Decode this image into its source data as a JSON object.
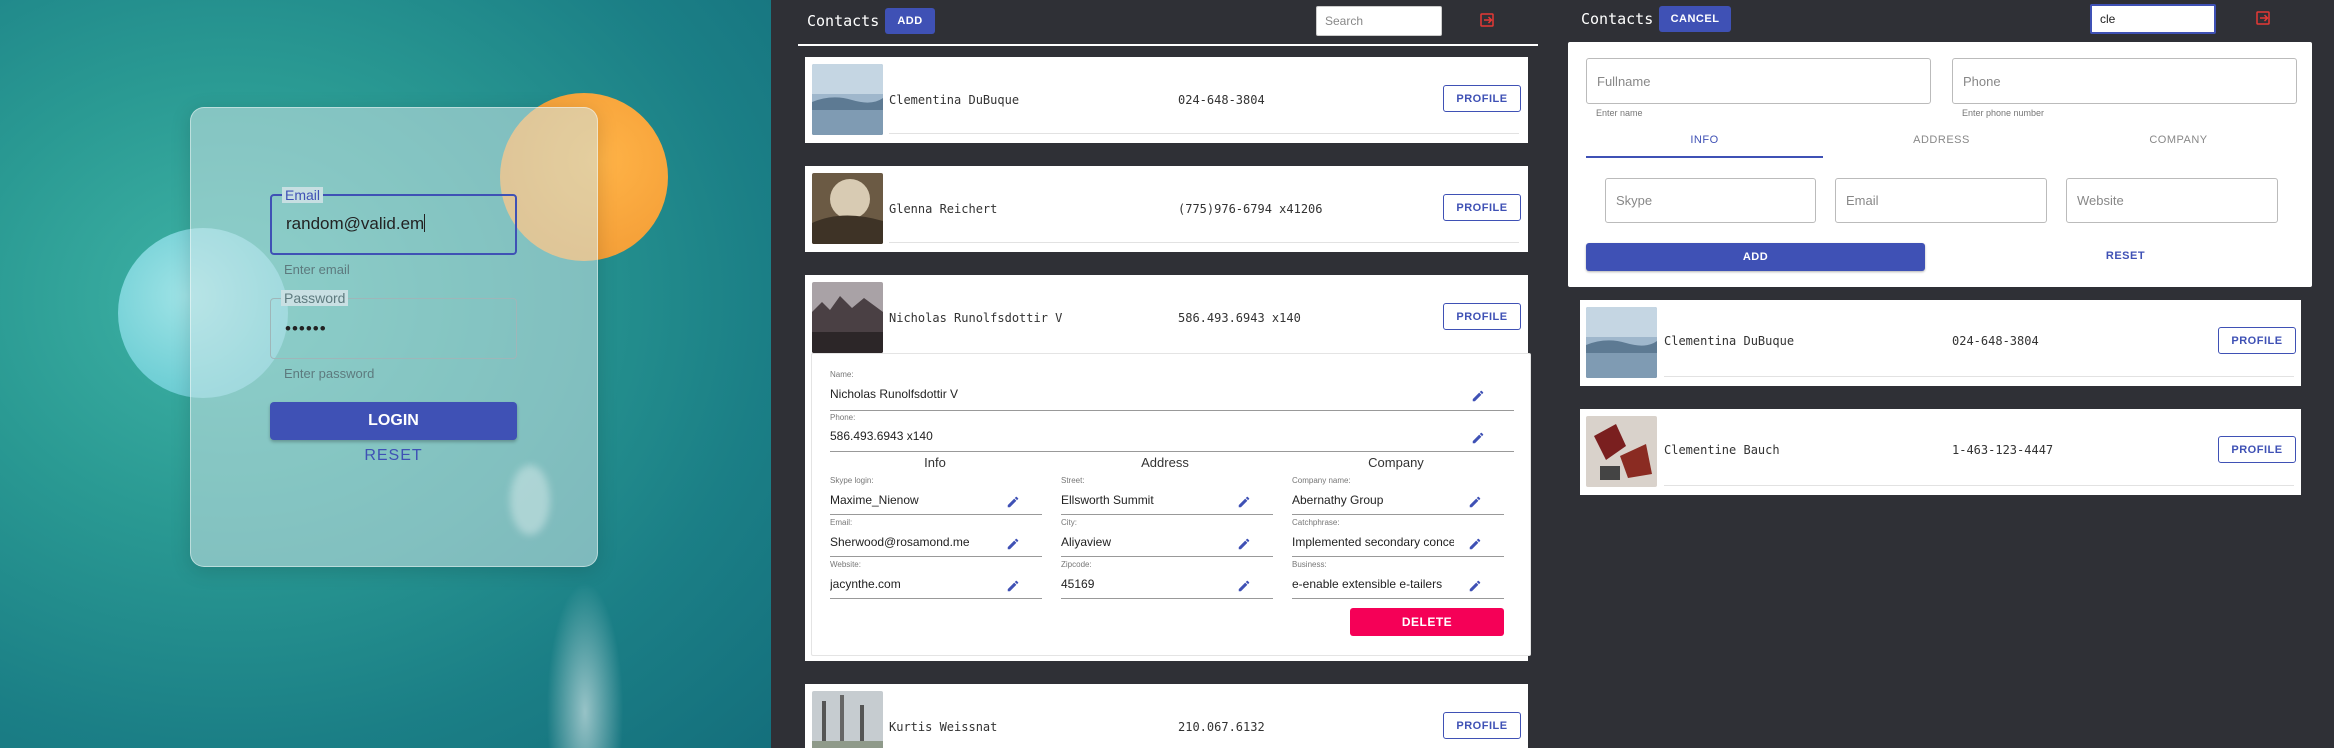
{
  "login": {
    "email_label": "Email",
    "email_value": "random@valid.em",
    "email_helper": "Enter email",
    "password_label": "Password",
    "password_value": "••••••",
    "password_helper": "Enter password",
    "login_label": "LOGIN",
    "reset_label": "RESET"
  },
  "list": {
    "title": "Contacts",
    "add_label": "ADD",
    "search_placeholder": "Search",
    "contacts": [
      {
        "name": "Clementina DuBuque",
        "phone": "024-648-3804",
        "profile_label": "PROFILE"
      },
      {
        "name": "Glenna Reichert",
        "phone": "(775)976-6794 x41206",
        "profile_label": "PROFILE"
      },
      {
        "name": "Nicholas Runolfsdottir V",
        "phone": "586.493.6943 x140",
        "profile_label": "PROFILE"
      },
      {
        "name": "Kurtis Weissnat",
        "phone": "210.067.6132",
        "profile_label": "PROFILE"
      }
    ],
    "detail": {
      "name_label": "Name:",
      "name_value": "Nicholas Runolfsdottir V",
      "phone_label": "Phone:",
      "phone_value": "586.493.6943 x140",
      "info_head": "Info",
      "address_head": "Address",
      "company_head": "Company",
      "skype_label": "Skype login:",
      "skype_value": "Maxime_Nienow",
      "email_label": "Email:",
      "email_value": "Sherwood@rosamond.me",
      "website_label": "Website:",
      "website_value": "jacynthe.com",
      "street_label": "Street:",
      "street_value": "Ellsworth Summit",
      "city_label": "City:",
      "city_value": "Aliyaview",
      "zipcode_label": "Zipcode:",
      "zipcode_value": "45169",
      "company_name_label": "Company name:",
      "company_name_value": "Abernathy Group",
      "catchphrase_label": "Catchphrase:",
      "catchphrase_value": "Implemented secondary concept",
      "business_label": "Business:",
      "business_value": "e-enable extensible e-tailers",
      "delete_label": "DELETE"
    }
  },
  "form": {
    "title": "Contacts",
    "cancel_label": "CANCEL",
    "search_value": "cle",
    "fullname_placeholder": "Fullname",
    "fullname_helper": "Enter name",
    "phone_placeholder": "Phone",
    "phone_helper": "Enter phone number",
    "tabs": [
      "INFO",
      "ADDRESS",
      "COMPANY"
    ],
    "skype_placeholder": "Skype",
    "email_placeholder": "Email",
    "website_placeholder": "Website",
    "add_label": "ADD",
    "reset_label": "RESET",
    "results": [
      {
        "name": "Clementina DuBuque",
        "phone": "024-648-3804",
        "profile_label": "PROFILE"
      },
      {
        "name": "Clementine Bauch",
        "phone": "1-463-123-4447",
        "profile_label": "PROFILE"
      }
    ]
  },
  "colors": {
    "primary": "#3f51b5",
    "danger": "#f50057",
    "appbar": "#2f3036"
  }
}
